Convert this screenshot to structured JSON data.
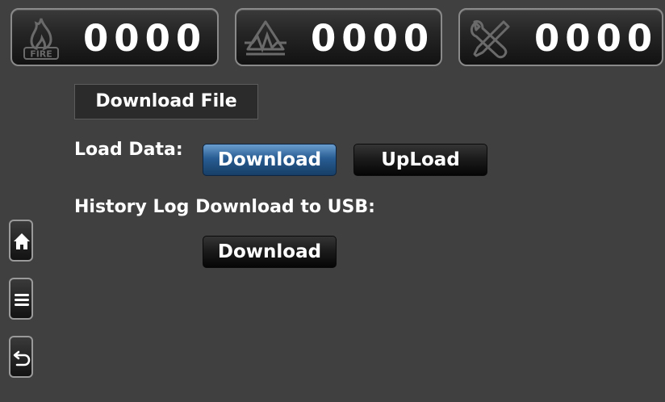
{
  "counters": [
    {
      "icon": "fire-icon",
      "icon_text": "FIRE",
      "value": "0000"
    },
    {
      "icon": "trouble-icon",
      "value": "0000"
    },
    {
      "icon": "tools-icon",
      "value": "0000"
    }
  ],
  "header": {
    "title": "Download File"
  },
  "load_data": {
    "label": "Load Data:",
    "download_label": "Download",
    "upload_label": "UpLoad"
  },
  "history": {
    "label": "History Log Download to USB:",
    "download_label": "Download"
  },
  "sidebar": [
    {
      "icon": "home-icon"
    },
    {
      "icon": "menu-icon"
    },
    {
      "icon": "back-icon"
    }
  ],
  "colors": {
    "background": "#404040",
    "active_button": "#285d93"
  }
}
